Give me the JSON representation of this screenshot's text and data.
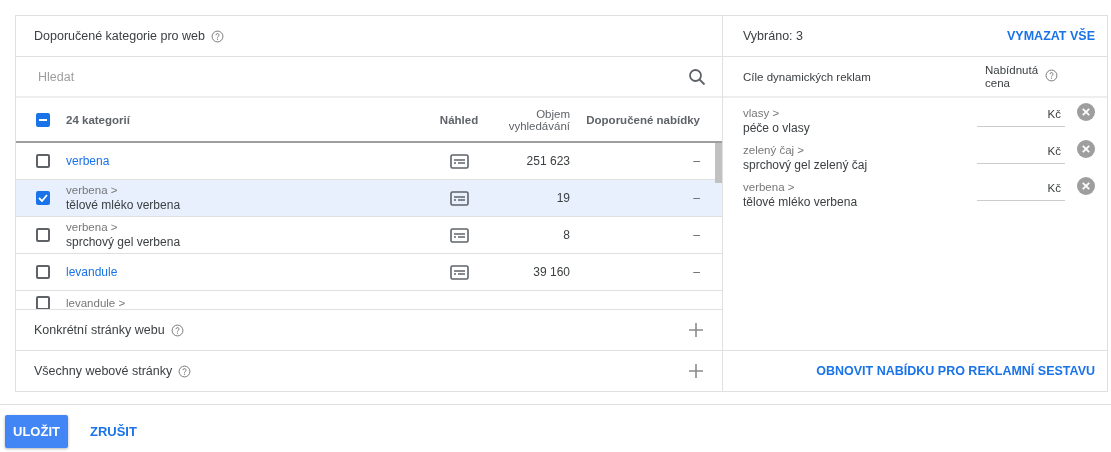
{
  "categories_panel": {
    "title": "Doporučené kategorie pro web",
    "search": {
      "placeholder": "Hledat"
    },
    "table": {
      "select_all": {
        "checked": true,
        "indeterminate": true
      },
      "columns": [
        "24 kategorií",
        "Náhled",
        "Objem vyhledávání",
        "Doporučené nabídky"
      ],
      "rows": [
        {
          "name": "verbena",
          "checked": false,
          "volume": "251 623",
          "bid": "–"
        },
        {
          "parent": "verbena >",
          "name": "tělové mléko verbena",
          "checked": true,
          "volume": "19",
          "bid": "–"
        },
        {
          "parent": "verbena >",
          "name": "sprchový gel verbena",
          "checked": false,
          "volume": "8",
          "bid": "–"
        },
        {
          "name": "levandule",
          "checked": false,
          "volume": "39 160",
          "bid": "–"
        },
        {
          "parent": "levandule >",
          "checked": false
        }
      ]
    },
    "sections": [
      {
        "label": "Konkrétní stránky webu"
      },
      {
        "label": "Všechny webové stránky"
      }
    ]
  },
  "selected_panel": {
    "count_label": "Vybráno: 3",
    "clear_all": "VYMAZAT VŠE",
    "columns": [
      "Cíle dynamických reklam",
      "Nabídnutá cena"
    ],
    "items": [
      {
        "parent": "vlasy >",
        "name": "péče o vlasy",
        "currency": "Kč"
      },
      {
        "parent": "zelený čaj >",
        "name": "sprchový gel zelený čaj",
        "currency": "Kč"
      },
      {
        "parent": "verbena >",
        "name": "tělové mléko verbena",
        "currency": "Kč"
      }
    ],
    "refresh_link": "OBNOVIT NABÍDKU PRO REKLAMNÍ SESTAVU"
  },
  "buttons": [
    {
      "label": "ULOŽIT",
      "kind": "primary"
    },
    {
      "label": "ZRUŠIT",
      "kind": "text"
    }
  ]
}
